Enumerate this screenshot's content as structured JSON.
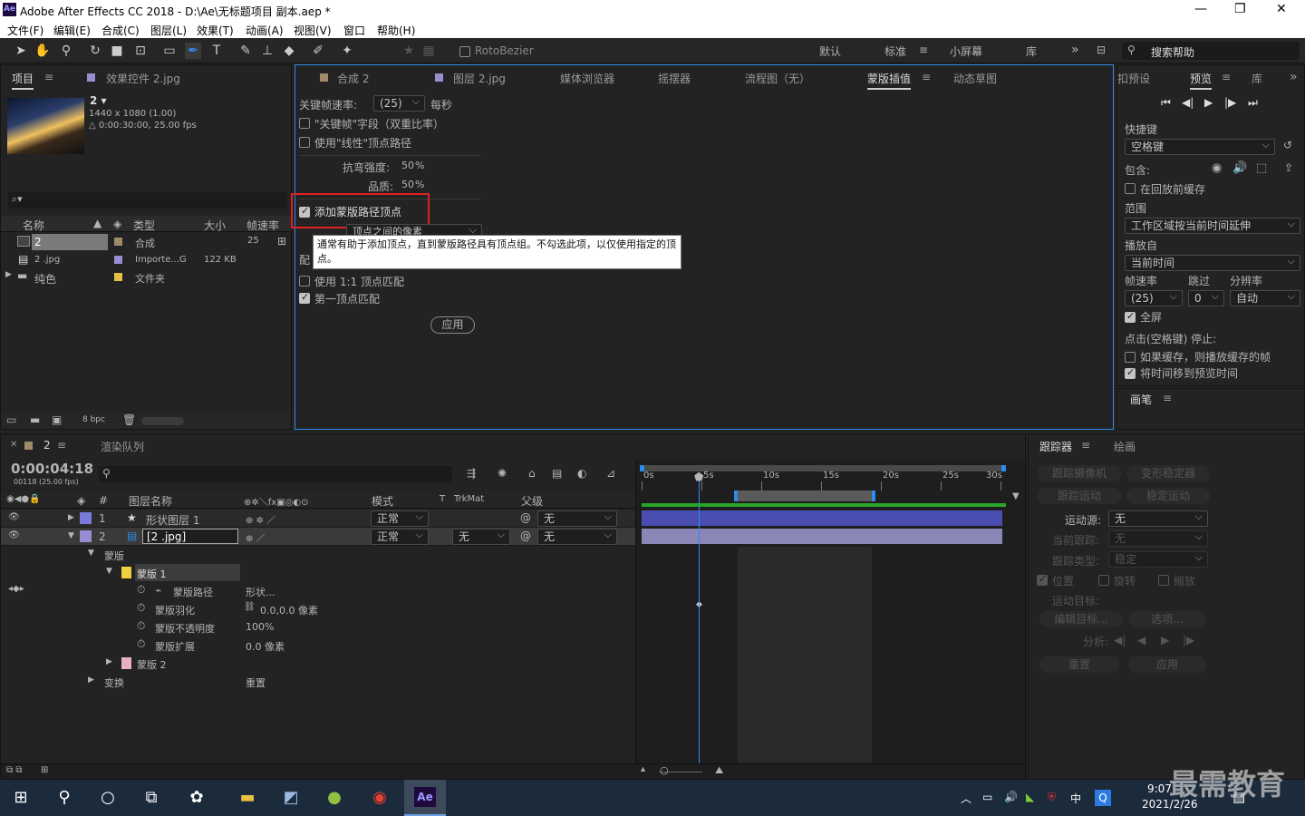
{
  "window": {
    "title": "Adobe After Effects CC 2018 - D:\\Ae\\无标题项目 副本.aep *",
    "logo": "Ae",
    "minimize": "—",
    "restore": "❐",
    "close": "✕"
  },
  "menu": [
    "文件(F)",
    "编辑(E)",
    "合成(C)",
    "图层(L)",
    "效果(T)",
    "动画(A)",
    "视图(V)",
    "窗口",
    "帮助(H)"
  ],
  "toolbar": {
    "rotobezier": "RotoBezier",
    "workspaces": [
      "默认",
      "标准",
      "小屏幕",
      "库"
    ],
    "active_workspace": "标准",
    "search_placeholder": "搜索帮助"
  },
  "project": {
    "tab": "项目",
    "effects_tab": "效果控件 2.jpg",
    "comp_name": "2 ▾",
    "info1": "1440 x 1080 (1.00)",
    "info2": "△ 0:00:30:00, 25.00 fps",
    "search_icon": "⌕▾",
    "columns": [
      "名称",
      "类型",
      "大小",
      "帧速率"
    ],
    "rows": [
      {
        "name": "2",
        "type": "合成",
        "size": "",
        "fps": "25",
        "color": "#a08a6a"
      },
      {
        "name": "2 .jpg",
        "type": "Importe...G",
        "size": "122 KB",
        "fps": "",
        "color": "#9a8cd0"
      },
      {
        "name": "纯色",
        "type": "文件夹",
        "size": "",
        "fps": "",
        "color": "#e4c24a"
      }
    ],
    "bpc": "8 bpc"
  },
  "center": {
    "tabs": [
      "合成 2",
      "图层 2.jpg",
      "媒体浏览器",
      "摇摆器",
      "流程图（无）",
      "蒙版插值",
      "动态草图"
    ],
    "active": "蒙版插值",
    "keyframe_rate_label": "关键帧速率:",
    "keyframe_rate_value": "(25)",
    "per_sec": "每秒",
    "opt1": "\"关键帧\"字段（双重比率）",
    "opt2": "使用\"线性\"顶点路径",
    "bend_label": "抗弯强度:",
    "bend_value": "50",
    "bend_unit": "%",
    "quality_label": "品质:",
    "quality_value": "50",
    "quality_unit": "%",
    "add_vertices": "添加蒙版路径顶点",
    "hidden_label": "配",
    "match11": "使用 1:1 顶点匹配",
    "first_vertex": "第一顶点匹配",
    "apply": "应用",
    "tooltip": "通常有助于添加顶点，直到蒙版路径具有顶点组。不勾选此项，以仅使用指定的顶点。",
    "partial": "顶点之间的像素"
  },
  "preview": {
    "tab_left": "扣预设",
    "tab": "预览",
    "tab_lib": "库",
    "shortcut_label": "快捷键",
    "shortcut_value": "空格键",
    "include_label": "包含:",
    "cache_before": "在回放前缓存",
    "range_label": "范围",
    "range_value": "工作区域按当前时间延伸",
    "play_from_label": "播放自",
    "play_from_value": "当前时间",
    "fps_label": "帧速率",
    "skip_label": "跳过",
    "res_label": "分辨率",
    "fps_value": "(25)",
    "skip_value": "0",
    "res_value": "自动",
    "fullscreen": "全屏",
    "stop_label": "点击(空格键) 停止:",
    "if_cache": "如果缓存，则播放缓存的帧",
    "move_time": "将时间移到预览时间",
    "brush_tab": "画笔"
  },
  "timeline": {
    "tab": "2",
    "render_queue": "渲染队列",
    "timecode": "0:00:04:18",
    "frames": "00118 (25.00 fps)",
    "cols": {
      "layer_name": "图层名称",
      "mode": "模式",
      "trkmat": "TrkMat",
      "parent": "父级"
    },
    "ruler": [
      "0s",
      "5s",
      "10s",
      "15s",
      "20s",
      "25s",
      "30s"
    ],
    "layers": [
      {
        "num": "1",
        "name": "形状图层 1",
        "mode": "正常",
        "trkmat": "",
        "parent": "无",
        "color": "#7a7adc"
      },
      {
        "num": "2",
        "name": "[2 .jpg]",
        "mode": "正常",
        "trkmat": "无",
        "parent": "无",
        "color": "#9a8cd0"
      }
    ],
    "props": [
      {
        "label": "蒙版",
        "value": "",
        "indent": 96
      },
      {
        "label": "蒙版 1",
        "value": "",
        "indent": 130
      },
      {
        "label": "蒙版路径",
        "value": "形状...",
        "indent": 170
      },
      {
        "label": "蒙版羽化",
        "value": "0.0,0.0 像素",
        "indent": 170
      },
      {
        "label": "蒙版不透明度",
        "value": "100%",
        "indent": 170
      },
      {
        "label": "蒙版扩展",
        "value": "0.0 像素",
        "indent": 170
      },
      {
        "label": "蒙版 2",
        "value": "",
        "indent": 130
      },
      {
        "label": "变换",
        "value": "重置",
        "indent": 96
      }
    ]
  },
  "tracker": {
    "tab": "跟踪器",
    "paint_tab": "绘画",
    "track_camera": "跟踪摄像机",
    "warp_stab": "变形稳定器",
    "track_motion": "跟踪运动",
    "stabilize": "稳定运动",
    "motion_source_label": "运动源:",
    "motion_source": "无",
    "current_track_label": "当前跟踪:",
    "current_track": "无",
    "track_type_label": "跟踪类型:",
    "track_type": "稳定",
    "position": "位置",
    "rotation": "旋转",
    "scale": "缩放",
    "motion_target": "运动目标:",
    "edit_target": "编辑目标...",
    "options": "选项...",
    "analyze": "分析:",
    "reset": "重置",
    "apply": "应用"
  },
  "taskbar": {
    "time": "9:07",
    "date": "2021/2/26",
    "ime": "中",
    "watermark": "最需教育"
  }
}
